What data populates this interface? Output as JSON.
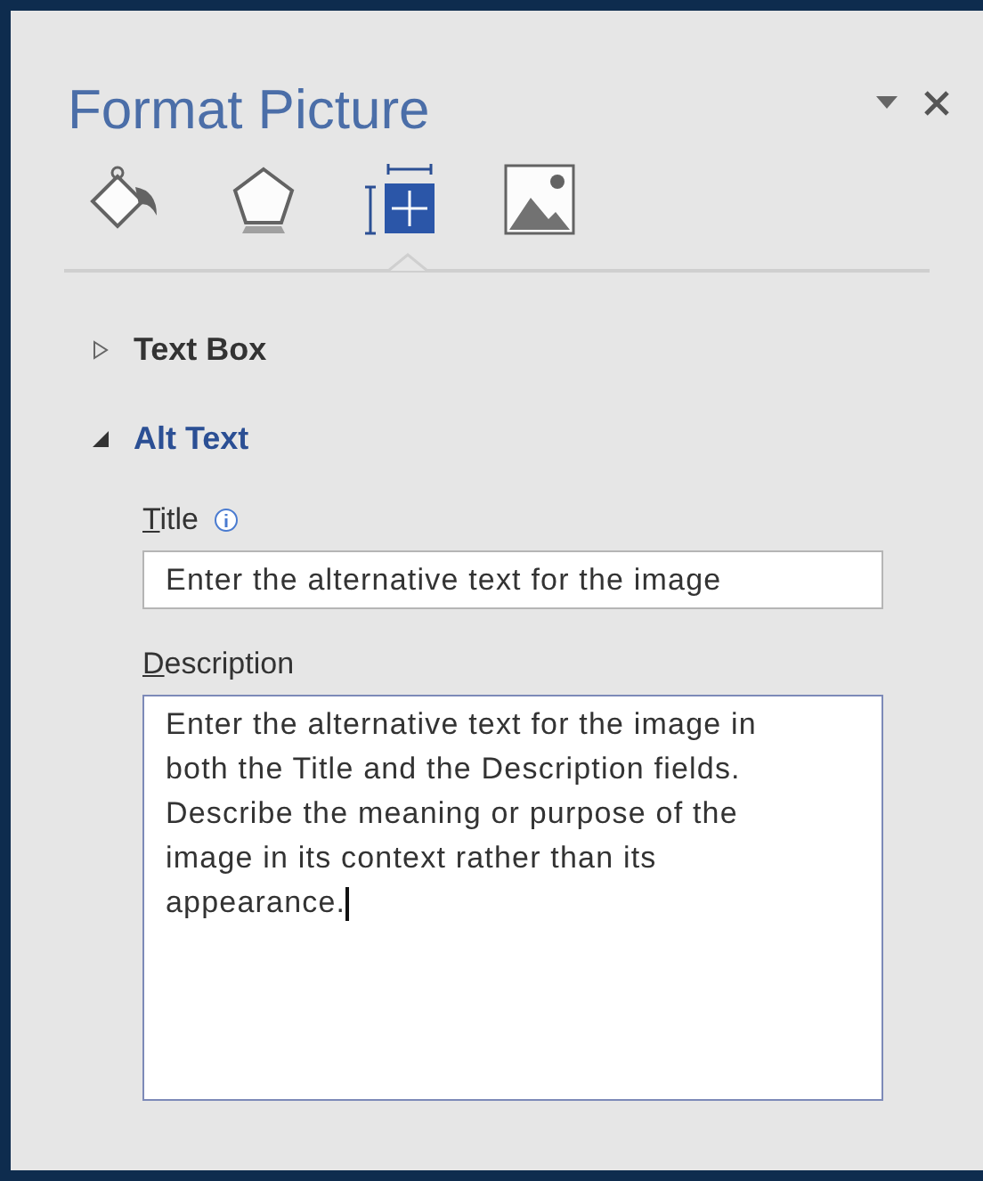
{
  "pane": {
    "title": "Format Picture"
  },
  "tabs": [
    {
      "kind": "fill",
      "selected": false
    },
    {
      "kind": "effects",
      "selected": false
    },
    {
      "kind": "layout",
      "selected": true
    },
    {
      "kind": "picture",
      "selected": false
    }
  ],
  "sections": [
    {
      "label": "Text Box",
      "expanded": false
    },
    {
      "label": "Alt Text",
      "expanded": true
    }
  ],
  "fields": [
    {
      "kind": "input",
      "label": "Title",
      "underline_first": true,
      "info": true,
      "value": "Enter the alternative text for the image",
      "focused": false
    },
    {
      "kind": "textarea",
      "label": "Description",
      "underline_first": true,
      "info": false,
      "value": "Enter the alternative text for the image in both the Title and the Description fields. Describe the meaning or purpose of the image in its context rather than its appearance.",
      "focused": true
    }
  ]
}
